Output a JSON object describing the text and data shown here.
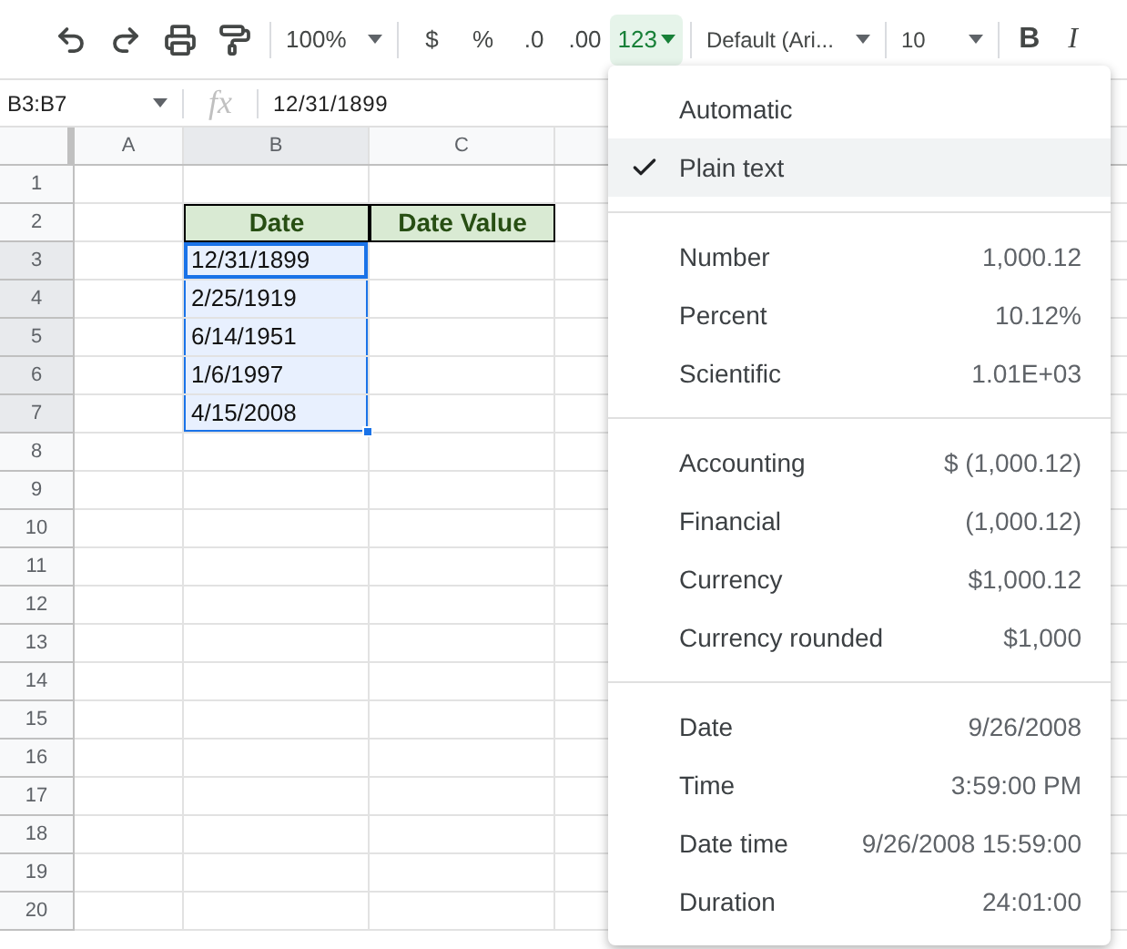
{
  "toolbar": {
    "zoom": "100%",
    "currency": "$",
    "percent": "%",
    "decimal_decrease": ".0",
    "decimal_increase": ".00",
    "format": "123",
    "format_open": true,
    "font": "Default (Ari...",
    "font_size": "10",
    "bold": "B",
    "italic": "I"
  },
  "formula_bar": {
    "name_box": "B3:B7",
    "fx": "fx",
    "value": "12/31/1899"
  },
  "columns": [
    {
      "label": "A",
      "selected": false
    },
    {
      "label": "B",
      "selected": true
    },
    {
      "label": "C",
      "selected": false
    }
  ],
  "rows": [
    {
      "label": "1",
      "selected": false,
      "cells": [
        {
          "kind": "empty"
        },
        {
          "kind": "empty"
        },
        {
          "kind": "empty"
        }
      ]
    },
    {
      "label": "2",
      "selected": false,
      "cells": [
        {
          "kind": "empty"
        },
        {
          "text": "Date",
          "kind": "header",
          "selected": false,
          "active": false
        },
        {
          "text": "Date Value",
          "kind": "header",
          "selected": false,
          "active": false
        }
      ]
    },
    {
      "label": "3",
      "selected": true,
      "cells": [
        {
          "kind": "empty"
        },
        {
          "text": "12/31/1899",
          "kind": "value",
          "selected": true,
          "active": true
        },
        {
          "kind": "empty"
        }
      ]
    },
    {
      "label": "4",
      "selected": true,
      "cells": [
        {
          "kind": "empty"
        },
        {
          "text": "2/25/1919",
          "kind": "value",
          "selected": true,
          "active": false
        },
        {
          "kind": "empty"
        }
      ]
    },
    {
      "label": "5",
      "selected": true,
      "cells": [
        {
          "kind": "empty"
        },
        {
          "text": "6/14/1951",
          "kind": "value",
          "selected": true,
          "active": false
        },
        {
          "kind": "empty"
        }
      ]
    },
    {
      "label": "6",
      "selected": true,
      "cells": [
        {
          "kind": "empty"
        },
        {
          "text": "1/6/1997",
          "kind": "value",
          "selected": true,
          "active": false
        },
        {
          "kind": "empty"
        }
      ]
    },
    {
      "label": "7",
      "selected": true,
      "cells": [
        {
          "kind": "empty"
        },
        {
          "text": "4/15/2008",
          "kind": "value",
          "selected": true,
          "active": false
        },
        {
          "kind": "empty"
        }
      ]
    },
    {
      "label": "8",
      "selected": false,
      "cells": [
        {
          "kind": "empty"
        },
        {
          "kind": "empty"
        },
        {
          "kind": "empty"
        }
      ]
    },
    {
      "label": "9",
      "selected": false,
      "cells": [
        {
          "kind": "empty"
        },
        {
          "kind": "empty"
        },
        {
          "kind": "empty"
        }
      ]
    },
    {
      "label": "10",
      "selected": false,
      "cells": [
        {
          "kind": "empty"
        },
        {
          "kind": "empty"
        },
        {
          "kind": "empty"
        }
      ]
    },
    {
      "label": "11",
      "selected": false,
      "cells": [
        {
          "kind": "empty"
        },
        {
          "kind": "empty"
        },
        {
          "kind": "empty"
        }
      ]
    },
    {
      "label": "12",
      "selected": false,
      "cells": [
        {
          "kind": "empty"
        },
        {
          "kind": "empty"
        },
        {
          "kind": "empty"
        }
      ]
    },
    {
      "label": "13",
      "selected": false,
      "cells": [
        {
          "kind": "empty"
        },
        {
          "kind": "empty"
        },
        {
          "kind": "empty"
        }
      ]
    },
    {
      "label": "14",
      "selected": false,
      "cells": [
        {
          "kind": "empty"
        },
        {
          "kind": "empty"
        },
        {
          "kind": "empty"
        }
      ]
    },
    {
      "label": "15",
      "selected": false,
      "cells": [
        {
          "kind": "empty"
        },
        {
          "kind": "empty"
        },
        {
          "kind": "empty"
        }
      ]
    },
    {
      "label": "16",
      "selected": false,
      "cells": [
        {
          "kind": "empty"
        },
        {
          "kind": "empty"
        },
        {
          "kind": "empty"
        }
      ]
    },
    {
      "label": "17",
      "selected": false,
      "cells": [
        {
          "kind": "empty"
        },
        {
          "kind": "empty"
        },
        {
          "kind": "empty"
        }
      ]
    },
    {
      "label": "18",
      "selected": false,
      "cells": [
        {
          "kind": "empty"
        },
        {
          "kind": "empty"
        },
        {
          "kind": "empty"
        }
      ]
    },
    {
      "label": "19",
      "selected": false,
      "cells": [
        {
          "kind": "empty"
        },
        {
          "kind": "empty"
        },
        {
          "kind": "empty"
        }
      ]
    },
    {
      "label": "20",
      "selected": false,
      "cells": [
        {
          "kind": "empty"
        },
        {
          "kind": "empty"
        },
        {
          "kind": "empty"
        }
      ]
    }
  ],
  "format_menu": {
    "sections": [
      [
        {
          "label": "Automatic",
          "checked": false
        },
        {
          "label": "Plain text",
          "checked": true
        }
      ],
      [
        {
          "label": "Number",
          "example": "1,000.12",
          "checked": false
        },
        {
          "label": "Percent",
          "example": "10.12%",
          "checked": false
        },
        {
          "label": "Scientific",
          "example": "1.01E+03",
          "checked": false
        }
      ],
      [
        {
          "label": "Accounting",
          "example": "$ (1,000.12)",
          "checked": false
        },
        {
          "label": "Financial",
          "example": "(1,000.12)",
          "checked": false
        },
        {
          "label": "Currency",
          "example": "$1,000.12",
          "checked": false
        },
        {
          "label": "Currency rounded",
          "example": "$1,000",
          "checked": false
        }
      ],
      [
        {
          "label": "Date",
          "example": "9/26/2008",
          "checked": false
        },
        {
          "label": "Time",
          "example": "3:59:00 PM",
          "checked": false
        },
        {
          "label": "Date time",
          "example": "9/26/2008 15:59:00",
          "checked": false
        },
        {
          "label": "Duration",
          "example": "24:01:00",
          "checked": false
        }
      ]
    ]
  }
}
